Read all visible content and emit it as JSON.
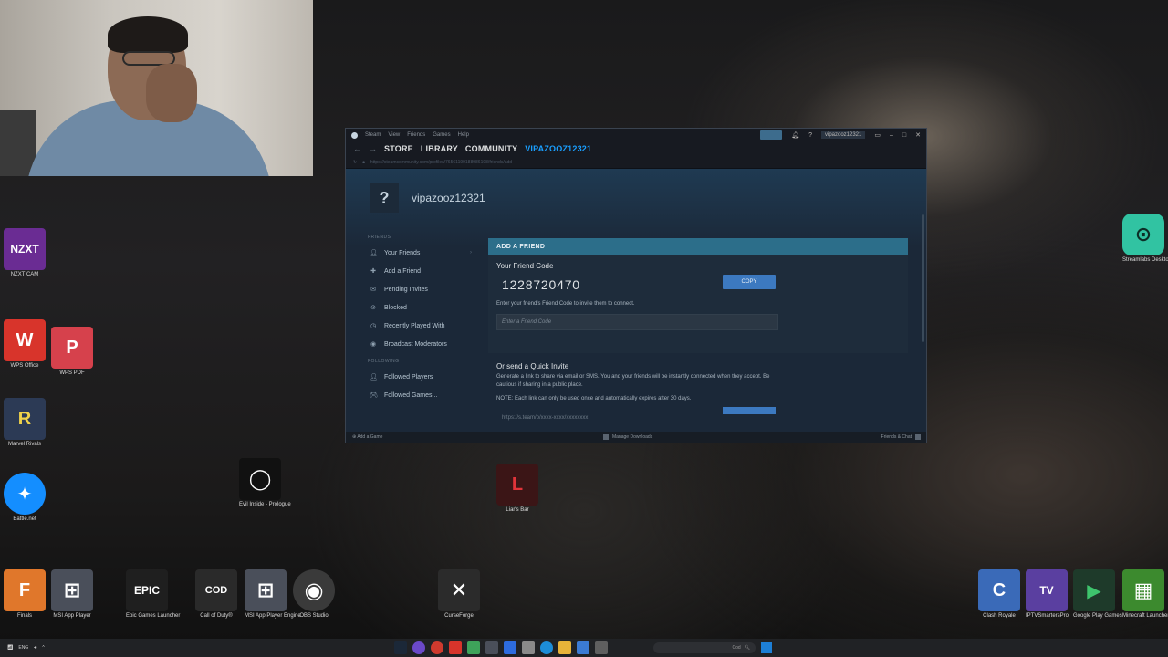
{
  "steam": {
    "titlebar": {
      "menu": [
        "Steam",
        "View",
        "Friends",
        "Games",
        "Help"
      ],
      "account": "vipazooz12321"
    },
    "nav": {
      "back": "←",
      "forward": "→",
      "items": [
        "STORE",
        "LIBRARY",
        "COMMUNITY",
        "VIPAZOOZ12321"
      ]
    },
    "url": "https://steamcommunity.com/profiles/76561199188986198/friends/add",
    "profile": {
      "avatar_glyph": "?",
      "name": "vipazooz12321"
    },
    "sidebar": {
      "friends_section": "FRIENDS",
      "following_section": "FOLLOWING",
      "items": [
        {
          "label": "Your Friends",
          "icon": "person-icon"
        },
        {
          "label": "Add a Friend",
          "icon": "add-person-icon"
        },
        {
          "label": "Pending Invites",
          "icon": "mail-icon"
        },
        {
          "label": "Blocked",
          "icon": "blocked-icon"
        },
        {
          "label": "Recently Played With",
          "icon": "clock-icon"
        },
        {
          "label": "Broadcast Moderators",
          "icon": "broadcast-icon"
        }
      ],
      "following": [
        {
          "label": "Followed Players",
          "icon": "person-icon"
        },
        {
          "label": "Followed Games...",
          "icon": "gamepad-icon"
        }
      ]
    },
    "add_friend": {
      "header": "ADD A FRIEND",
      "code_label": "Your Friend Code",
      "code_value": "1228720470",
      "copy_label": "COPY",
      "hint": "Enter your friend's Friend Code to invite them to connect.",
      "input_placeholder": "Enter a Friend Code",
      "quick_title": "Or send a Quick Invite",
      "quick_desc": "Generate a link to share via email or SMS. You and your friends will be instantly connected when they accept. Be cautious if sharing in a public place.",
      "quick_note": "NOTE: Each link can only be used once and automatically expires after 30 days.",
      "link_text": "https://s.team/p/xxxx-xxxx/xxxxxxxx"
    },
    "statusbar": {
      "add_game": "Add a Game",
      "manage_downloads": "Manage Downloads",
      "friends_chat": "Friends & Chat"
    }
  },
  "desktop_icons": {
    "nzxt": {
      "tile": "NZXT",
      "label": "NZXT CAM",
      "color": "#6a2c93"
    },
    "wps_office": {
      "tile": "W",
      "label": "WPS Office",
      "color": "#d8342b"
    },
    "wps_pdf": {
      "tile": "P",
      "label": "WPS PDF",
      "color": "#d6414c"
    },
    "marvel_rivals": {
      "tile": "R",
      "label": "Marvel Rivals",
      "color": "#2c3a55"
    },
    "battlenet": {
      "tile": "✦",
      "label": "Battle.net",
      "color": "#148eff"
    },
    "evil_inside": {
      "tile": "◯",
      "label": "Evil Inside - Prologue",
      "color": "#111111"
    },
    "liars_bar": {
      "tile": "L",
      "label": "Liar's Bar",
      "color": "#3b1516"
    },
    "streamlabs": {
      "tile": "⊙",
      "label": "Streamlabs Desktop",
      "color": "#31c3a2"
    },
    "finals": {
      "tile": "F",
      "label": "Finals",
      "color": "#e0772b"
    },
    "msi_player": {
      "tile": "⊞",
      "label": "MSI App Player",
      "color": "#4a4f5a"
    },
    "epic": {
      "tile": "EPIC",
      "label": "Epic Games Launcher",
      "color": "#1f1f1f"
    },
    "cod": {
      "tile": "COD",
      "label": "Call of Duty®",
      "color": "#2a2a2a"
    },
    "msi_engine": {
      "tile": "⊞",
      "label": "MSI App Player Engine",
      "color": "#4a4f5a"
    },
    "obs": {
      "tile": "◉",
      "label": "OBS Studio",
      "color": "#3a3a3a"
    },
    "curseforge": {
      "tile": "✕",
      "label": "CurseForge",
      "color": "#2b2b2b"
    },
    "clash": {
      "tile": "C",
      "label": "Clash Royale",
      "color": "#3a6ab8"
    },
    "iptv": {
      "tile": "TV",
      "label": "IPTVSmartersPro",
      "color": "#5a3fa0"
    },
    "google_play": {
      "tile": "▶",
      "label": "Google Play Games",
      "color": "#1e3a2a"
    },
    "minecraft": {
      "tile": "▦",
      "label": "Minecraft Launcher",
      "color": "#3c8a2e"
    }
  },
  "taskbar": {
    "lang": "ENG",
    "search_text": "Cod"
  }
}
